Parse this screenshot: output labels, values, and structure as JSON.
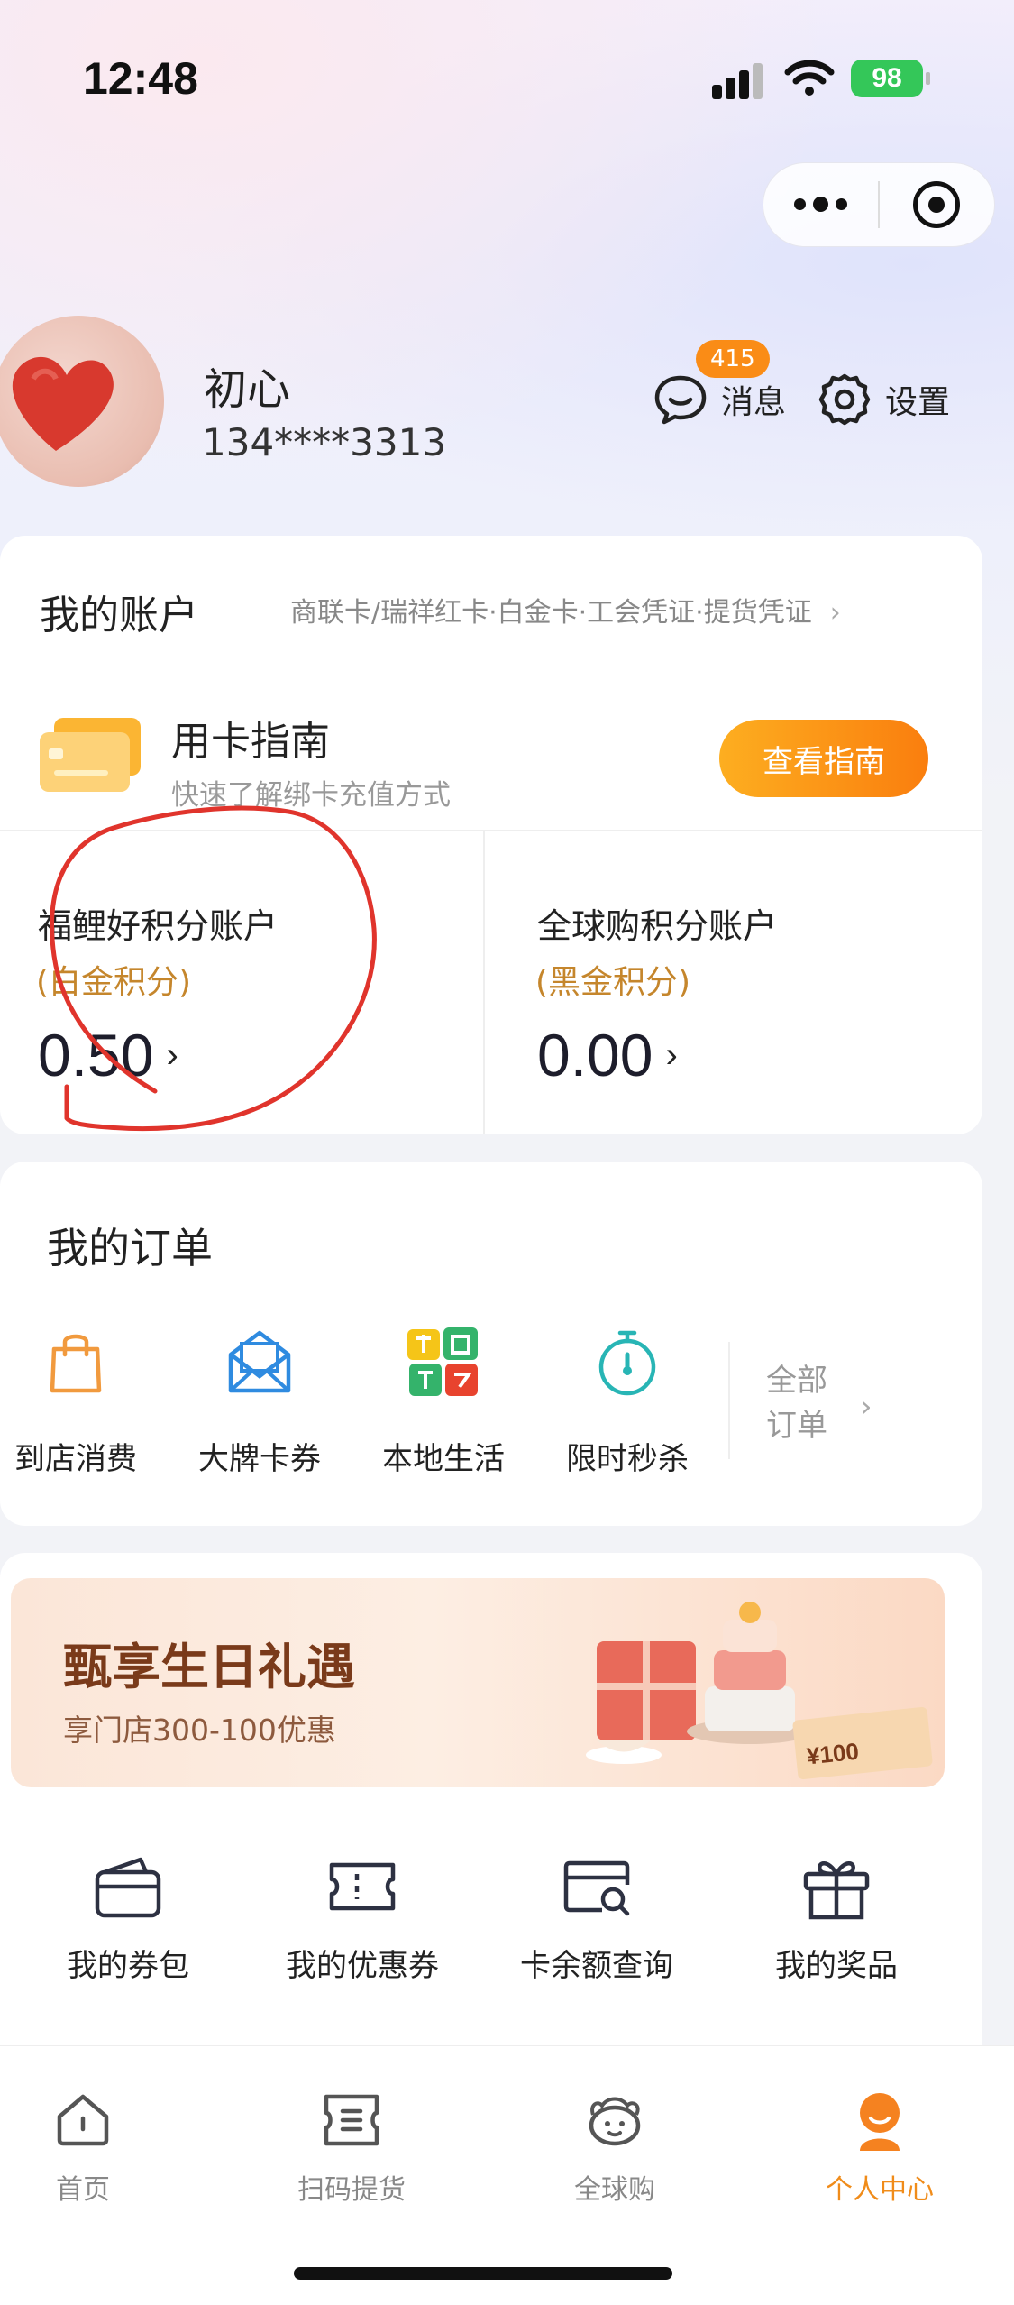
{
  "status_bar": {
    "time": "12:48",
    "battery": "98"
  },
  "profile": {
    "nickname": "初心",
    "phone": "134****3313",
    "message_label": "消息",
    "message_badge": "415",
    "settings_label": "设置"
  },
  "account": {
    "title": "我的账户",
    "subtitle": "商联卡/瑞祥红卡·白金卡·工会凭证·提货凭证",
    "guide_title": "用卡指南",
    "guide_sub": "快速了解绑卡充值方式",
    "guide_button": "查看指南",
    "points": [
      {
        "name": "福鲤好积分账户",
        "type": "(白金积分)",
        "value": "0.50"
      },
      {
        "name": "全球购积分账户",
        "type": "(黑金积分)",
        "value": "0.00"
      }
    ]
  },
  "orders": {
    "title": "我的订单",
    "items": [
      {
        "label": "到店消费",
        "icon": "shopping-bag-icon"
      },
      {
        "label": "大牌卡券",
        "icon": "envelope-icon"
      },
      {
        "label": "本地生活",
        "icon": "eat-drink-play-icon"
      },
      {
        "label": "限时秒杀",
        "icon": "stopwatch-icon"
      }
    ],
    "all_label": "全部订单"
  },
  "banner": {
    "title": "甄享生日礼遇",
    "subtitle": "享门店300-100优惠",
    "coupon_value": "¥100"
  },
  "services": [
    {
      "label": "我的券包",
      "icon": "wallet-icon"
    },
    {
      "label": "我的优惠券",
      "icon": "ticket-icon"
    },
    {
      "label": "卡余额查询",
      "icon": "card-search-icon"
    },
    {
      "label": "我的奖品",
      "icon": "gift-icon"
    }
  ],
  "tabbar": [
    {
      "label": "首页",
      "icon": "home-icon"
    },
    {
      "label": "扫码提货",
      "icon": "scan-icon"
    },
    {
      "label": "全球购",
      "icon": "global-shop-icon"
    },
    {
      "label": "个人中心",
      "icon": "profile-icon",
      "active": true
    }
  ],
  "colors": {
    "accent": "#fa8c16",
    "points_type": "#c5862c",
    "annotation": "#e0342c"
  }
}
